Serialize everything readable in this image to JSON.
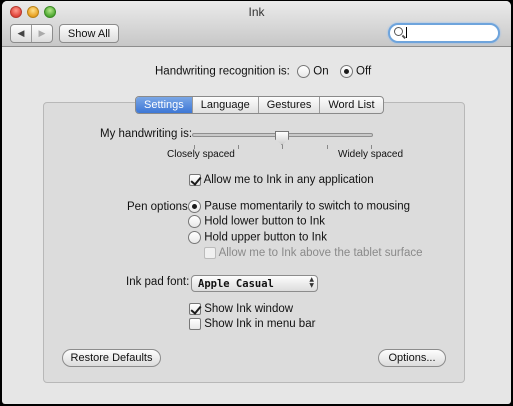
{
  "window": {
    "title": "Ink"
  },
  "toolbar": {
    "back_icon": "chevron-left",
    "forward_icon": "chevron-right",
    "show_all_label": "Show All",
    "search_value": ""
  },
  "recognition": {
    "label": "Handwriting recognition is:",
    "on_label": "On",
    "off_label": "Off",
    "selected": "Off"
  },
  "tabs": [
    {
      "label": "Settings",
      "active": true
    },
    {
      "label": "Language",
      "active": false
    },
    {
      "label": "Gestures",
      "active": false
    },
    {
      "label": "Word List",
      "active": false
    }
  ],
  "settings": {
    "handwriting_label": "My handwriting is:",
    "slider_min_label": "Closely spaced",
    "slider_max_label": "Widely spaced",
    "slider_value": 0.5,
    "allow_any_app_label": "Allow me to Ink in any application",
    "allow_any_app_checked": true,
    "pen_options_label": "Pen options:",
    "pen_options": [
      {
        "label": "Pause momentarily to switch to mousing",
        "selected": true
      },
      {
        "label": "Hold lower button to Ink",
        "selected": false
      },
      {
        "label": "Hold upper button to Ink",
        "selected": false
      }
    ],
    "above_surface_label": "Allow me to Ink above the tablet surface",
    "above_surface_checked": false,
    "font_label": "Ink pad font:",
    "font_value": "Apple Casual",
    "show_window_label": "Show Ink window",
    "show_window_checked": true,
    "show_menubar_label": "Show Ink in menu bar",
    "show_menubar_checked": false,
    "restore_label": "Restore Defaults",
    "options_label": "Options..."
  }
}
